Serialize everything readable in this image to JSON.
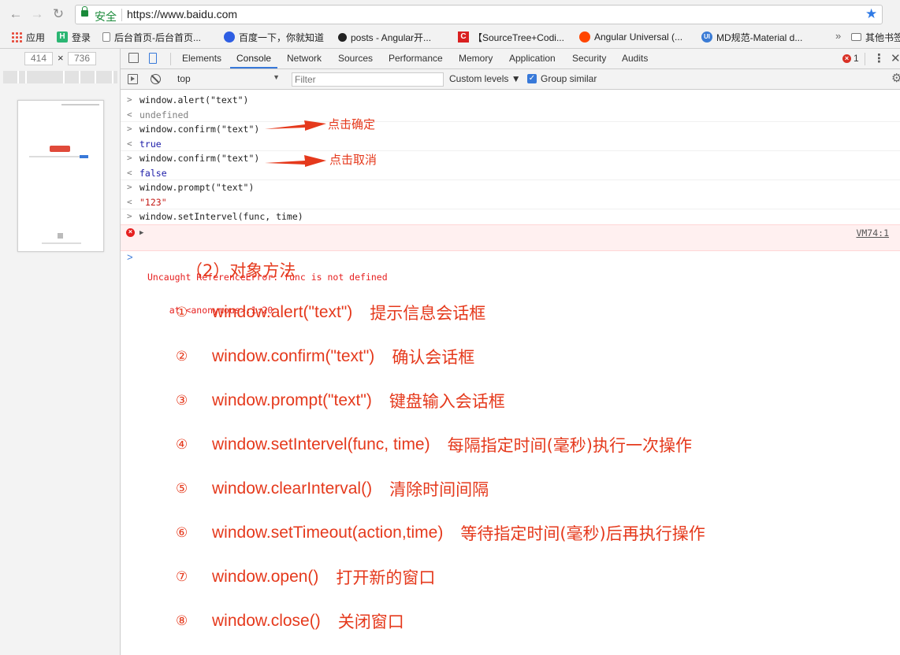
{
  "browser": {
    "secure_label": "安全",
    "url": "https://www.baidu.com",
    "bookmarks": [
      {
        "label": "应用",
        "icon": "apps-grid-icon"
      },
      {
        "label": "登录",
        "icon": "h-logo-icon"
      },
      {
        "label": "后台首页-后台首页...",
        "icon": "page-icon"
      },
      {
        "label": "百度一下，你就知道",
        "icon": "baidu-paw-icon"
      },
      {
        "label": "posts - Angular开...",
        "icon": "github-icon"
      },
      {
        "label": "【SourceTree+Codi...",
        "icon": "c-logo-icon"
      },
      {
        "label": "Angular Universal (...",
        "icon": "reddit-icon"
      },
      {
        "label": "MD规范-Material d...",
        "icon": "ui-logo-icon"
      },
      {
        "label": "其他书签",
        "icon": "folder-icon"
      }
    ]
  },
  "device": {
    "width": "414",
    "x": "×",
    "height": "736"
  },
  "devtools": {
    "tabs": [
      "Elements",
      "Console",
      "Network",
      "Sources",
      "Performance",
      "Memory",
      "Application",
      "Security",
      "Audits"
    ],
    "active_tab": "Console",
    "error_count": "1",
    "context": "top",
    "filter_placeholder": "Filter",
    "levels_label": "Custom levels ▼",
    "group_similar_label": "Group similar"
  },
  "console": {
    "lines": [
      {
        "prefix": ">",
        "text": "window.alert(\"text\")"
      },
      {
        "prefix": "<",
        "text": "undefined"
      },
      {
        "prefix": ">",
        "text": "window.confirm(\"text\")"
      },
      {
        "prefix": "<",
        "text": "true"
      },
      {
        "prefix": ">",
        "text": "window.confirm(\"text\")"
      },
      {
        "prefix": "<",
        "text": "false"
      },
      {
        "prefix": ">",
        "text": "window.prompt(\"text\")"
      },
      {
        "prefix": "<",
        "text": "\"123\""
      },
      {
        "prefix": ">",
        "text": "window.setIntervel(func, time)"
      }
    ],
    "error_line1": "Uncaught ReferenceError: func is not defined",
    "error_line2": "    at <anonymous>:1:20",
    "error_source": "VM74:1",
    "prompt": ">"
  },
  "annotations": {
    "confirm_ok": "点击确定",
    "confirm_cancel": "点击取消"
  },
  "notes": {
    "title": "（2）对象方法",
    "items": [
      {
        "num": "①",
        "code": "window.alert(\"text\")",
        "desc": "提示信息会话框"
      },
      {
        "num": "②",
        "code": "window.confirm(\"text\")",
        "desc": "确认会话框"
      },
      {
        "num": "③",
        "code": "window.prompt(\"text\")",
        "desc": "键盘输入会话框"
      },
      {
        "num": "④",
        "code": "window.setIntervel(func, time)",
        "desc": "每隔指定时间(毫秒)执行一次操作"
      },
      {
        "num": "⑤",
        "code": "window.clearInterval()",
        "desc": "清除时间间隔"
      },
      {
        "num": "⑥",
        "code": "window.setTimeout(action,time)",
        "desc": "等待指定时间(毫秒)后再执行操作"
      },
      {
        "num": "⑦",
        "code": "window.open()",
        "desc": "打开新的窗口"
      },
      {
        "num": "⑧",
        "code": "window.close()",
        "desc": "关闭窗口"
      }
    ]
  },
  "colors": {
    "accent": "#e5391c",
    "error": "#e62020",
    "devtools_blue": "#3879d9",
    "secure_green": "#1a8a3a"
  }
}
